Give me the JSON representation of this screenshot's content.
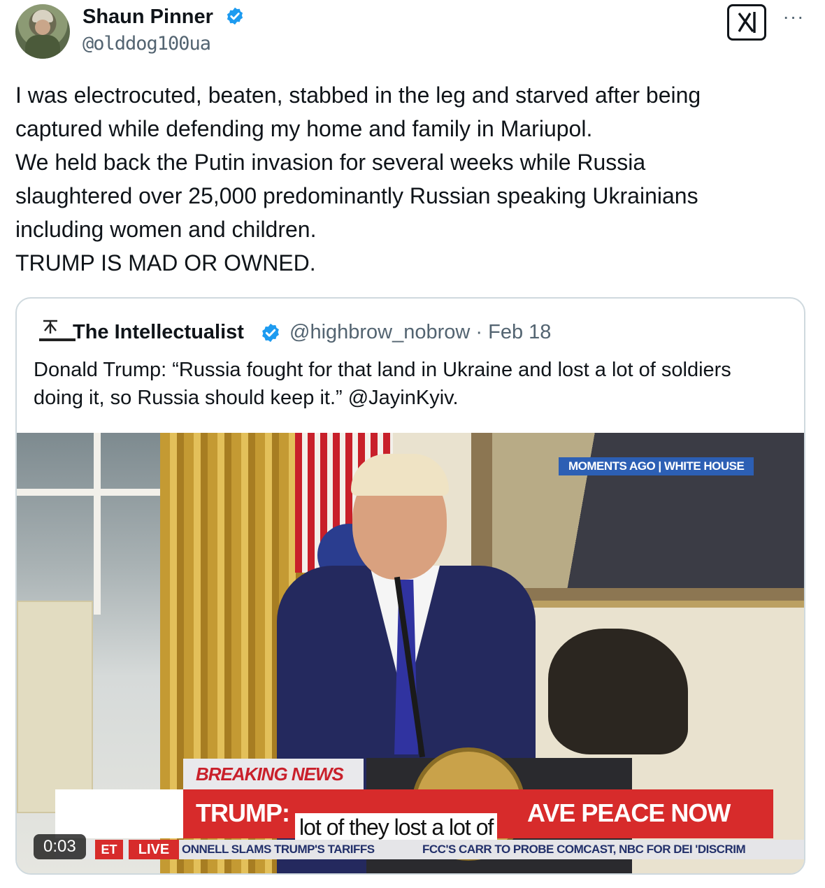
{
  "author": {
    "name": "Shaun Pinner",
    "handle": "@olddog100ua",
    "verified": true,
    "avatar_icon": "profile-photo"
  },
  "actions": {
    "grok_icon": "grok-icon",
    "more_label": "···"
  },
  "tweet": {
    "text": "I was electrocuted, beaten, stabbed in the leg and starved after being\ncaptured while defending my home and family in Mariupol.\nWe held back the Putin invasion for several weeks while Russia\nslaughtered over 25,000 predominantly Russian speaking Ukrainians\nincluding women and children.\nTRUMP IS MAD OR OWNED."
  },
  "quote": {
    "name": "The Intellectualist",
    "handle_date": "@highbrow_nobrow · Feb 18",
    "verified": true,
    "avatar_caption": "The Intellectualist",
    "text": "Donald Trump: “Russia fought for that land in Ukraine and lost a lot of soldiers\ndoing it, so Russia should keep it.” @JayinKyiv.",
    "video": {
      "badge": "MOMENTS AGO | WHITE HOUSE",
      "breaking": "BREAKING NEWS",
      "headline_left": "TRUMP:",
      "headline_right": "AVE PEACE NOW",
      "caption": "lot of they lost a lot of",
      "ticker_et": "ET",
      "ticker_live": "LIVE",
      "ticker_1": "ONNELL SLAMS TRUMP'S TARIFFS",
      "ticker_2": "FCC'S CARR TO PROBE COMCAST, NBC FOR DEI 'DISCRIM",
      "time": "0:03"
    }
  },
  "colors": {
    "verified_blue": "#1d9bf0",
    "text": "#0f1419",
    "secondary": "#536471",
    "border": "#cfd9de",
    "news_red": "#d72b2b"
  }
}
